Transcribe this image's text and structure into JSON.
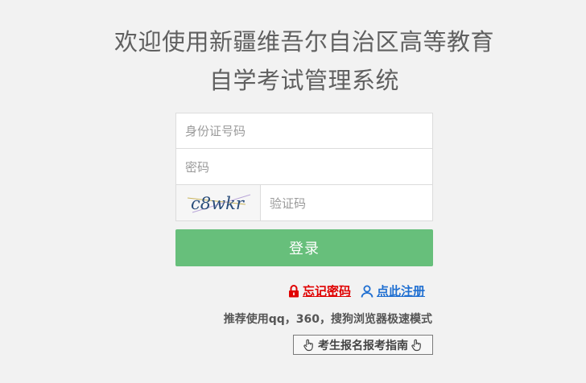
{
  "title": {
    "line1": "欢迎使用新疆维吾尔自治区高等教育",
    "line2": "自学考试管理系统"
  },
  "form": {
    "id_placeholder": "身份证号码",
    "password_placeholder": "密码",
    "captcha_text": "c8wkr",
    "captcha_placeholder": "验证码",
    "login_label": "登录"
  },
  "links": {
    "forgot_password": "忘记密码",
    "register": "点此注册"
  },
  "tip": "推荐使用qq，360，搜狗浏览器极速模式",
  "guide_label": "考生报名报考指南",
  "colors": {
    "login_button": "#67bf7b",
    "forgot_link": "#e00000",
    "register_link": "#1f6fd1"
  }
}
